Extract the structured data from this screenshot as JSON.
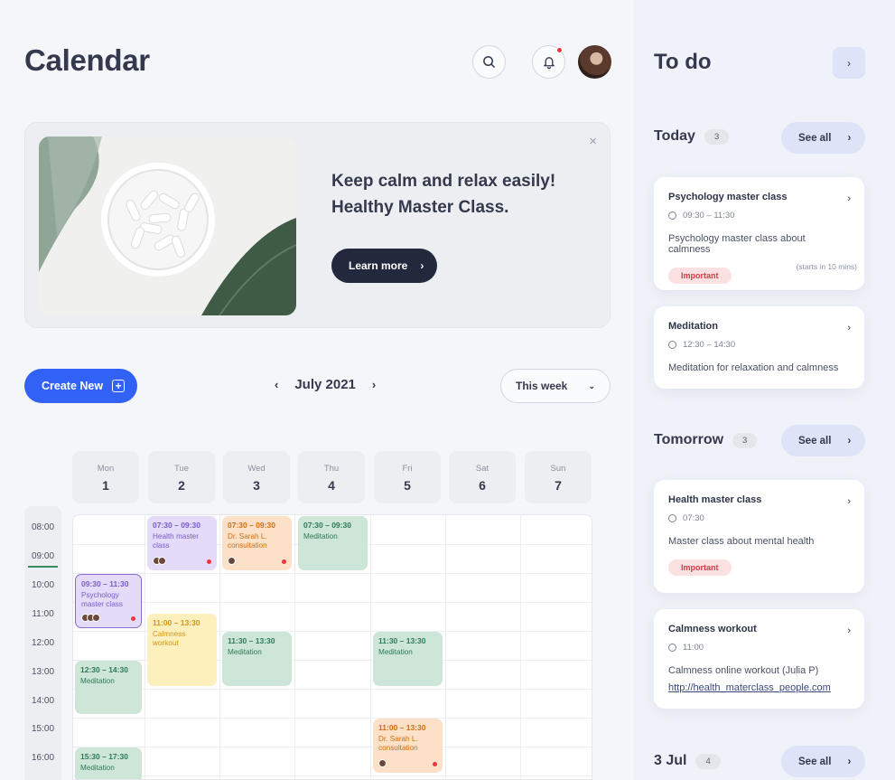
{
  "header": {
    "title": "Calendar"
  },
  "banner": {
    "title_line1": "Keep calm and relax easily!",
    "title_line2": "Healthy Master Class.",
    "cta": "Learn more",
    "close": "×"
  },
  "toolbar": {
    "create": "Create New",
    "month": "July 2021",
    "range": "This week"
  },
  "days": [
    {
      "name": "Mon",
      "num": "1"
    },
    {
      "name": "Tue",
      "num": "2"
    },
    {
      "name": "Wed",
      "num": "3"
    },
    {
      "name": "Thu",
      "num": "4"
    },
    {
      "name": "Fri",
      "num": "5"
    },
    {
      "name": "Sat",
      "num": "6"
    },
    {
      "name": "Sun",
      "num": "7"
    }
  ],
  "times": [
    "08:00",
    "09:00",
    "10:00",
    "11:00",
    "12:00",
    "13:00",
    "14:00",
    "15:00",
    "16:00"
  ],
  "events": [
    {
      "time": "07:30 – 09:30",
      "title": "Health master class"
    },
    {
      "time": "07:30 – 09:30",
      "title": "Dr. Sarah L. consultation"
    },
    {
      "time": "07:30 – 09:30",
      "title": "Meditation"
    },
    {
      "time": "09:30 – 11:30",
      "title": "Psychology master class"
    },
    {
      "time": "11:00 – 13:30",
      "title": "Calmness workout"
    },
    {
      "time": "11:30 – 13:30",
      "title": "Meditation"
    },
    {
      "time": "11:30 – 13:30",
      "title": "Meditation"
    },
    {
      "time": "12:30 – 14:30",
      "title": "Meditation"
    },
    {
      "time": "11:00 – 13:30",
      "title": "Dr. Sarah L. consultation"
    },
    {
      "time": "15:30 – 17:30",
      "title": "Meditation"
    }
  ],
  "todo": {
    "title": "To do",
    "see_all": "See all",
    "today": {
      "label": "Today",
      "count": "3"
    },
    "tomorrow": {
      "label": "Tomorrow",
      "count": "3"
    },
    "jul3": {
      "label": "3 Jul",
      "count": "4"
    },
    "cards": [
      {
        "title": "Psychology master class",
        "time": "09:30 – 11:30",
        "desc": "Psychology master class about calmness",
        "tag": "Important",
        "note": "(starts in 10 mins)"
      },
      {
        "title": "Meditation",
        "time": "12:30 – 14:30",
        "desc": "Meditation for relaxation and calmness"
      },
      {
        "title": "Health master class",
        "time": "07:30",
        "desc": "Master class about mental health",
        "tag": "Important"
      },
      {
        "title": "Calmness workout",
        "time": "11:00",
        "desc": "Calmness online workout (Julia P)",
        "link": "http://health_materclass_people.com"
      }
    ]
  }
}
